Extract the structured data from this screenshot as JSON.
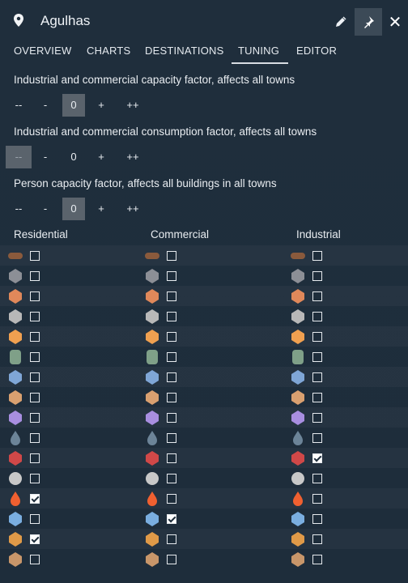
{
  "window": {
    "title": "Agulhas"
  },
  "toolbar": {
    "close_glyph": "✕"
  },
  "tabs": [
    {
      "label": "OVERVIEW",
      "active": false
    },
    {
      "label": "CHARTS",
      "active": false
    },
    {
      "label": "DESTINATIONS",
      "active": false
    },
    {
      "label": "TUNING",
      "active": true
    },
    {
      "label": "EDITOR",
      "active": false
    }
  ],
  "factors": [
    {
      "label": "Industrial and commercial capacity factor, affects all towns",
      "dec2": "--",
      "dec1": "-",
      "value": "0",
      "inc1": "+",
      "inc2": "++"
    },
    {
      "label": "Industrial and commercial consumption factor, affects all towns",
      "dec2": "--",
      "dec1": "-",
      "value": "0",
      "inc1": "+",
      "inc2": "++"
    },
    {
      "label": "Person capacity factor, affects all buildings in all towns",
      "dec2": "--",
      "dec1": "-",
      "value": "0",
      "inc1": "+",
      "inc2": "++"
    }
  ],
  "columns": {
    "residential": "Residential",
    "commercial": "Commercial",
    "industrial": "Industrial"
  },
  "cargo_rows": [
    {
      "icon": "logs-icon",
      "color": "#8a5a3c",
      "residential": false,
      "commercial": false,
      "industrial": false
    },
    {
      "icon": "stone-icon",
      "color": "#8c8f96",
      "residential": false,
      "commercial": false,
      "industrial": false
    },
    {
      "icon": "ore-icon",
      "color": "#e0885a",
      "residential": false,
      "commercial": false,
      "industrial": false
    },
    {
      "icon": "coal-icon",
      "color": "#b8b8b8",
      "residential": false,
      "commercial": false,
      "industrial": false
    },
    {
      "icon": "grain-icon",
      "color": "#f0a050",
      "residential": false,
      "commercial": false,
      "industrial": false
    },
    {
      "icon": "oil-barrel-icon",
      "color": "#7fa088",
      "residential": false,
      "commercial": false,
      "industrial": false
    },
    {
      "icon": "steel-icon",
      "color": "#7fa6d6",
      "residential": false,
      "commercial": false,
      "industrial": false
    },
    {
      "icon": "planks-icon",
      "color": "#d9a070",
      "residential": false,
      "commercial": false,
      "industrial": false
    },
    {
      "icon": "plastic-icon",
      "color": "#a88ee0",
      "residential": false,
      "commercial": false,
      "industrial": false
    },
    {
      "icon": "fuel-drop-icon",
      "color": "#6c8498",
      "residential": false,
      "commercial": false,
      "industrial": false
    },
    {
      "icon": "bricks-icon",
      "color": "#d04848",
      "residential": false,
      "commercial": false,
      "industrial": true
    },
    {
      "icon": "gear-icon",
      "color": "#c8c8c8",
      "residential": false,
      "commercial": false,
      "industrial": false
    },
    {
      "icon": "fire-icon",
      "color": "#f06030",
      "residential": true,
      "commercial": false,
      "industrial": false
    },
    {
      "icon": "wrench-icon",
      "color": "#7aaee0",
      "residential": false,
      "commercial": true,
      "industrial": false
    },
    {
      "icon": "bread-icon",
      "color": "#e09a48",
      "residential": true,
      "commercial": false,
      "industrial": false
    },
    {
      "icon": "goods-box-icon",
      "color": "#c8966a",
      "residential": false,
      "commercial": false,
      "industrial": false
    }
  ]
}
